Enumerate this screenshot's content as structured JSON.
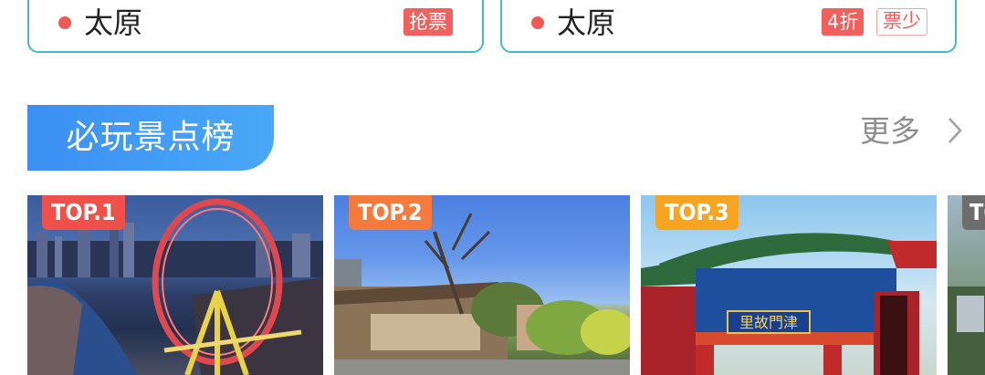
{
  "tickets": [
    {
      "city": "太原",
      "tags": [
        "抢票"
      ]
    },
    {
      "city": "太原",
      "tags": [
        "4折",
        "票少"
      ]
    }
  ],
  "section": {
    "title": "必玩景点榜",
    "more_label": "更多"
  },
  "attractions": [
    {
      "rank": "TOP.1",
      "image": "天津之眼摩天轮夜景"
    },
    {
      "rank": "TOP.2",
      "image": "五大道洋楼"
    },
    {
      "rank": "TOP.3",
      "image": "天津古文化街牌坊"
    },
    {
      "rank": "TO",
      "image": "景点四"
    }
  ],
  "colors": {
    "accent_blue": "#3b90f3",
    "tag_red": "#f25f5c",
    "card_border": "#47b7c9",
    "top1": "#f0504a",
    "top2": "#f67a3c",
    "top3": "#f7a521"
  },
  "paifang_sign": "里故門津"
}
